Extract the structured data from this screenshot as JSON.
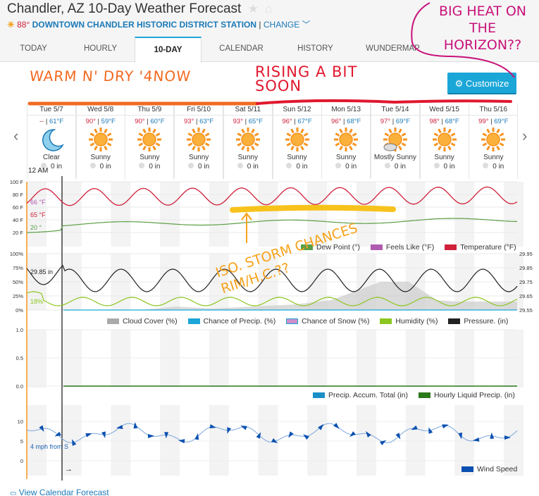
{
  "header": {
    "title": "Chandler, AZ 10-Day Weather Forecast",
    "star_icon": "★",
    "home_icon": "⌂",
    "current_temp": "88°",
    "station": "DOWNTOWN CHANDLER HISTORIC DISTRICT STATION",
    "separator": "|",
    "change_label": "CHANGE",
    "change_chevron": "﹀"
  },
  "tabs": [
    {
      "label": "TODAY"
    },
    {
      "label": "HOURLY"
    },
    {
      "label": "10-DAY",
      "active": true
    },
    {
      "label": "CALENDAR"
    },
    {
      "label": "HISTORY"
    },
    {
      "label": "WUNDERMAP"
    }
  ],
  "customize_label": "Customize",
  "nav": {
    "prev": "‹",
    "next": "›"
  },
  "days": [
    {
      "name": "Tue 5/7",
      "hi": "--",
      "lo": "61°F",
      "cond": "Clear",
      "icon": "moon",
      "precip": "0 in"
    },
    {
      "name": "Wed 5/8",
      "hi": "90°",
      "lo": "59°F",
      "cond": "Sunny",
      "icon": "sun",
      "precip": "0 in"
    },
    {
      "name": "Thu 5/9",
      "hi": "90°",
      "lo": "60°F",
      "cond": "Sunny",
      "icon": "sun",
      "precip": "0 in"
    },
    {
      "name": "Fri 5/10",
      "hi": "93°",
      "lo": "63°F",
      "cond": "Sunny",
      "icon": "sun",
      "precip": "0 in"
    },
    {
      "name": "Sat 5/11",
      "hi": "93°",
      "lo": "65°F",
      "cond": "Sunny",
      "icon": "sun",
      "precip": "0 in"
    },
    {
      "name": "Sun 5/12",
      "hi": "96°",
      "lo": "67°F",
      "cond": "Sunny",
      "icon": "sun",
      "precip": "0 in"
    },
    {
      "name": "Mon 5/13",
      "hi": "96°",
      "lo": "68°F",
      "cond": "Sunny",
      "icon": "sun",
      "precip": "0 in"
    },
    {
      "name": "Tue 5/14",
      "hi": "97°",
      "lo": "69°F",
      "cond": "Mostly Sunny",
      "icon": "partly",
      "precip": "0 in"
    },
    {
      "name": "Wed 5/15",
      "hi": "98°",
      "lo": "68°F",
      "cond": "Sunny",
      "icon": "sun",
      "precip": "0 in"
    },
    {
      "name": "Thu 5/16",
      "hi": "99°",
      "lo": "69°F",
      "cond": "Sunny",
      "icon": "sun",
      "precip": "0 in"
    }
  ],
  "time_label": "12 AM",
  "temp_chart": {
    "yticks": [
      "100 F",
      "80 F",
      "60 F",
      "40 F",
      "20 F"
    ],
    "readouts": {
      "feels": "66 °F",
      "temp": "65 °F",
      "dew": "20 °"
    },
    "legend": [
      "Dew Point (°)",
      "Feels Like (°F)",
      "Temperature (°F)"
    ],
    "colors": {
      "dew": "#5a9e44",
      "feels": "#b05ab0",
      "temp": "#d0203a"
    }
  },
  "pct_chart": {
    "yticks_left": [
      "100%",
      "75%",
      "50%",
      "25%",
      "0%"
    ],
    "yticks_right": [
      "29.95",
      "29.85",
      "29.75",
      "29.65",
      "29.55"
    ],
    "readouts": {
      "pressure": "29.85 in",
      "humidity": "18%"
    },
    "legend": [
      "Cloud Cover (%)",
      "Chance of Precip. (%)",
      "Chance of Snow (%)",
      "Humidity (%)",
      "Pressure. (in)"
    ],
    "colors": {
      "cloud": "#aaaaaa",
      "precip": "#1ba6d8",
      "snow": "#cc8fcc",
      "humidity": "#8cc620",
      "pressure": "#222222"
    }
  },
  "precip_chart": {
    "yticks": [
      "1.0",
      "0.5",
      "0.0"
    ],
    "legend": [
      "Precip. Accum. Total (in)",
      "Hourly Liquid Precip. (in)"
    ],
    "colors": {
      "accum": "#1a8fc7",
      "hourly": "#2a7a1a"
    }
  },
  "wind_chart": {
    "yticks": [
      "10",
      "5",
      "0"
    ],
    "readout": "4 mph from S",
    "legend": [
      "Wind Speed"
    ],
    "colors": {
      "wind": "#0b50b0"
    },
    "arrow": "→"
  },
  "footer": {
    "icon": "🗓",
    "link": "View Calendar Forecast"
  },
  "annotations": {
    "orange": "WARM N' DRY '4NOW",
    "red": "RISING A BIT SOON",
    "magenta": "BIG HEAT ON THE HORIZON??",
    "yellow": "ISO. STORM CHANCES RIM/H.C.??"
  }
}
